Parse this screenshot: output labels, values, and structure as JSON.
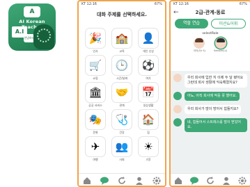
{
  "app_icon": {
    "chip_text": "A",
    "brand": "AI Korean Teacher",
    "board_text": "A.I",
    "bubble_text": "안녕하세요"
  },
  "status": {
    "time": "KT 12:16",
    "right": "67%"
  },
  "phone1": {
    "title": "대화 주제를 선택하세요.",
    "topics": [
      {
        "icon": "party-popper-icon",
        "glyph": "🎉",
        "label": "인사"
      },
      {
        "icon": "school-icon",
        "glyph": "🏫",
        "label": "교육"
      },
      {
        "icon": "person-icon",
        "glyph": "👤",
        "label": "개인 신상"
      },
      {
        "icon": "shopping-cart-icon",
        "glyph": "🛒",
        "label": "쇼핑"
      },
      {
        "icon": "clock-icon",
        "glyph": "🕒",
        "label": "시간/날짜"
      },
      {
        "icon": "hobby-icon",
        "glyph": "⚽",
        "label": "여가"
      },
      {
        "icon": "public-building-icon",
        "glyph": "🏛",
        "label": "공공 서비스"
      },
      {
        "icon": "handshake-icon",
        "glyph": "🤝",
        "label": "관계"
      },
      {
        "icon": "calendar-icon",
        "glyph": "📅",
        "label": "일상생활"
      },
      {
        "icon": "theater-masks-icon",
        "glyph": "🎭",
        "label": "문화"
      },
      {
        "icon": "first-aid-icon",
        "glyph": "🩺",
        "label": "건강"
      },
      {
        "icon": "house-icon",
        "glyph": "🏠",
        "label": "집"
      },
      {
        "icon": "airplane-icon",
        "glyph": "✈",
        "label": "여행"
      },
      {
        "icon": "society-icon",
        "glyph": "👥",
        "label": "사회"
      },
      {
        "icon": "weather-icon",
        "glyph": "☀",
        "label": "기후"
      }
    ]
  },
  "nav": {
    "items": [
      "home-icon",
      "chat-icon",
      "refresh-icon",
      "profile-icon",
      "settings-icon"
    ],
    "active_label": "Chat"
  },
  "phone2": {
    "title": "2급-관계-동료",
    "tabs": [
      "역할 연습",
      "미션&어휘"
    ],
    "select_role": "selectRole",
    "roles": [
      {
        "name": "이이(Sir S)"
      },
      {
        "name": "Sekster(나)"
      }
    ],
    "messages": [
      {
        "from": "user",
        "text": "우리 회사에 입한 지 이제 두 달 됐어요 그런데 회사 생활에 익숙해졌지요?"
      },
      {
        "from": "bot",
        "text": "아뇨, 아직 회사에 적응 못 했어요."
      },
      {
        "from": "user",
        "text": "우리 회사가 많이 방아서 힘들지요?"
      },
      {
        "from": "bot",
        "text": "네, 힘들어서 스트레스를 많이 받았어요."
      }
    ]
  }
}
